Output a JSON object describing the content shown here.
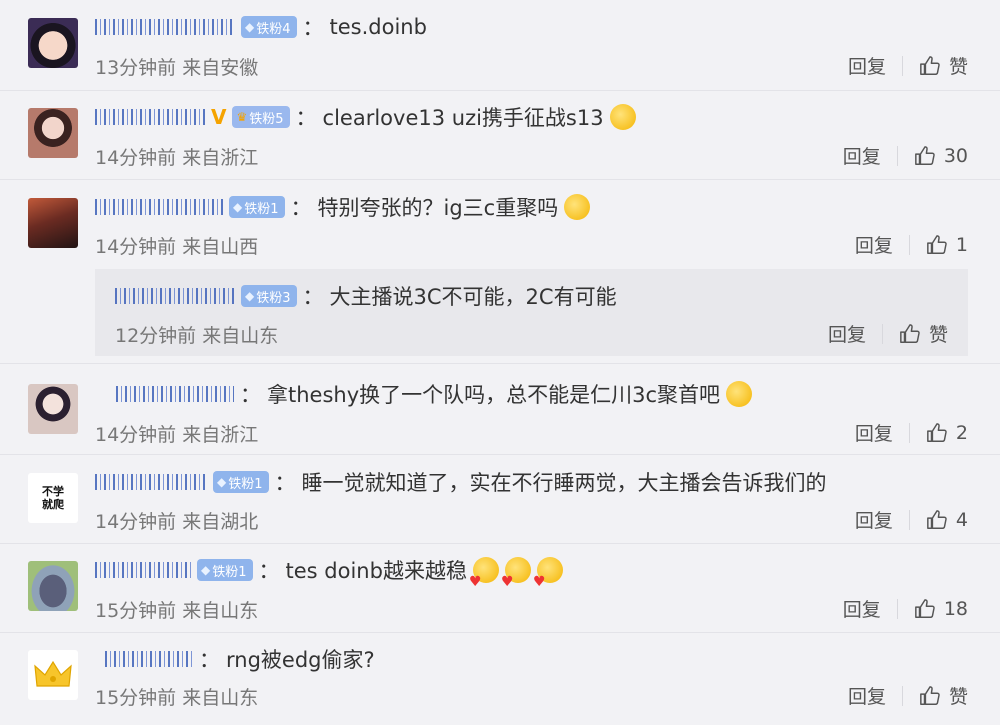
{
  "comments": [
    {
      "badge": "铁粉4",
      "text": "tes.doinb",
      "meta": "13分钟前 来自安徽",
      "reply": "回复",
      "likes": "赞",
      "avatar_bg": "#3b2c55"
    },
    {
      "badge": "铁粉5",
      "text": "clearlove13 uzi携手征战s13",
      "meta": "14分钟前 来自浙江",
      "reply": "回复",
      "likes": "30",
      "avatar_bg": "#b67a6b"
    },
    {
      "badge": "铁粉1",
      "text": "特别夸张的？ig三c重聚吗",
      "meta": "14分钟前 来自山西",
      "reply": "回复",
      "likes": "1",
      "avatar_bg": "#6b2b22"
    },
    {
      "badge": "铁粉3",
      "text": "大主播说3C不可能，2C有可能",
      "meta": "12分钟前 来自山东",
      "reply": "回复",
      "likes": "赞"
    },
    {
      "text": "拿theshy换了一个队吗，总不能是仁川3c聚首吧",
      "meta": "14分钟前 来自浙江",
      "reply": "回复",
      "likes": "2",
      "avatar_bg": "#d9c7c2"
    },
    {
      "badge": "铁粉1",
      "text": "睡一觉就知道了，实在不行睡两觉，大主播会告诉我们的",
      "meta": "14分钟前 来自湖北",
      "reply": "回复",
      "likes": "4",
      "avatar_text": "不学\n就爬"
    },
    {
      "badge": "铁粉1",
      "text": "tes doinb越来越稳",
      "meta": "15分钟前 来自山东",
      "reply": "回复",
      "likes": "18",
      "avatar_bg": "#8fa2b8"
    },
    {
      "text": "rng被edg偷家?",
      "meta": "15分钟前 来自山东",
      "reply": "回复",
      "likes": "赞",
      "avatar_bg": "#ffffff"
    }
  ],
  "colors": {
    "badge": "#8fb4ec",
    "nick": "#3c60b8",
    "meta": "#777777"
  },
  "icons": {
    "like": "thumbs-up-icon",
    "badge": "diamond-icon",
    "vip": "vip-v-icon"
  }
}
